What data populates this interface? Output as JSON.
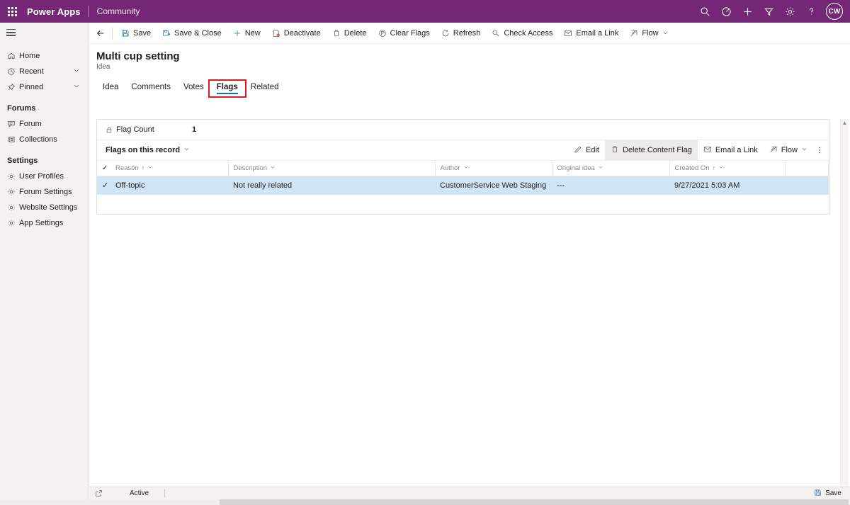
{
  "topbar": {
    "waffle_label": "app-launcher",
    "brand": "Power Apps",
    "environment": "Community",
    "icons": [
      {
        "name": "search-icon",
        "label": "Search"
      },
      {
        "name": "assistant-icon",
        "label": "Assistant"
      },
      {
        "name": "add-icon",
        "label": "New"
      },
      {
        "name": "filter-icon",
        "label": "Filter"
      },
      {
        "name": "settings-gear-icon",
        "label": "Settings"
      },
      {
        "name": "help-icon",
        "label": "Help"
      }
    ],
    "avatar_initials": "CW",
    "brand_color": "#742774"
  },
  "sidebar": {
    "items": [
      {
        "label": "Home",
        "icon": "home-icon",
        "chevron": false
      },
      {
        "label": "Recent",
        "icon": "clock-icon",
        "chevron": true
      },
      {
        "label": "Pinned",
        "icon": "pin-icon",
        "chevron": true
      }
    ],
    "group_forums": "Forums",
    "forum_items": [
      {
        "label": "Forum",
        "icon": "forum-icon"
      },
      {
        "label": "Collections",
        "icon": "collections-icon"
      }
    ],
    "group_settings": "Settings",
    "settings_items": [
      {
        "label": "User Profiles",
        "icon": "gear-icon"
      },
      {
        "label": "Forum Settings",
        "icon": "gear-icon"
      },
      {
        "label": "Website Settings",
        "icon": "gear-icon"
      },
      {
        "label": "App Settings",
        "icon": "gear-icon"
      }
    ]
  },
  "commandbar": {
    "back_label": "Back",
    "buttons": [
      {
        "label": "Save",
        "icon": "save-icon"
      },
      {
        "label": "Save & Close",
        "icon": "save-close-icon"
      },
      {
        "label": "New",
        "icon": "plus-icon"
      },
      {
        "label": "Deactivate",
        "icon": "deactivate-icon"
      },
      {
        "label": "Delete",
        "icon": "trash-icon"
      },
      {
        "label": "Clear Flags",
        "icon": "clear-flags-icon"
      },
      {
        "label": "Refresh",
        "icon": "refresh-icon"
      },
      {
        "label": "Check Access",
        "icon": "check-access-icon"
      },
      {
        "label": "Email a Link",
        "icon": "email-link-icon"
      },
      {
        "label": "Flow",
        "icon": "flow-icon",
        "chevron": true
      }
    ]
  },
  "record": {
    "title": "Multi cup setting",
    "subtitle": "Idea"
  },
  "tabs": [
    {
      "label": "Idea",
      "selected": false
    },
    {
      "label": "Comments",
      "selected": false
    },
    {
      "label": "Votes",
      "selected": false
    },
    {
      "label": "Flags",
      "selected": true,
      "highlighted": true
    },
    {
      "label": "Related",
      "selected": false
    }
  ],
  "form": {
    "flag_count_label": "Flag Count",
    "flag_count_value": "1",
    "lock_icon": "lock-icon"
  },
  "subgrid": {
    "title": "Flags on this record",
    "commands": [
      {
        "label": "Edit",
        "icon": "edit-pencil-icon",
        "active": false
      },
      {
        "label": "Delete Content Flag",
        "icon": "trash-icon",
        "active": true
      },
      {
        "label": "Email a Link",
        "icon": "email-link-icon",
        "active": false
      },
      {
        "label": "Flow",
        "icon": "flow-icon",
        "active": false,
        "chevron": true
      }
    ],
    "more_icon": "overflow-menu-icon",
    "columns": [
      {
        "label": "Reason",
        "sort": "asc"
      },
      {
        "label": "Description",
        "sort": null
      },
      {
        "label": "Author",
        "sort": null
      },
      {
        "label": "Original idea",
        "sort": null
      },
      {
        "label": "Created On",
        "sort": "asc"
      }
    ],
    "rows": [
      {
        "selected": true,
        "reason": "Off-topic",
        "description": "Not really related",
        "author": "CustomerService Web Staging",
        "original_idea": "---",
        "created_on": "9/27/2021 5:03 AM"
      }
    ],
    "selected_row_color": "#cfe4f5",
    "link_color": "#1b3f7a"
  },
  "statusbar": {
    "open_form_icon": "open-in-new-icon",
    "status": "Active",
    "save_label": "Save",
    "save_icon": "save-icon"
  }
}
